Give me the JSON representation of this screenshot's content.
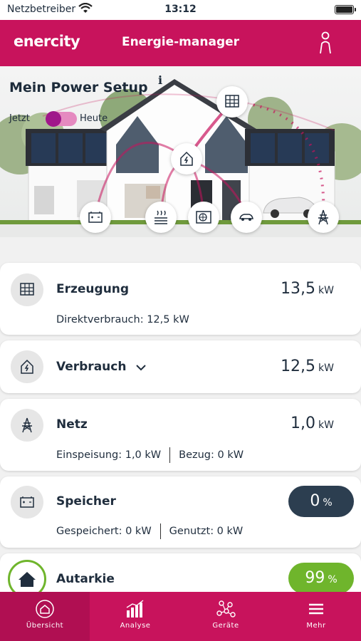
{
  "status_bar": {
    "carrier": "Netzbetreiber",
    "time": "13:12"
  },
  "app_bar": {
    "brand": "enercity",
    "title": "Energie-manager",
    "user_icon": "user-icon"
  },
  "hero": {
    "title": "Mein Power Setup",
    "info_icon": "i",
    "toggle_left": "Jetzt",
    "toggle_right": "Heute",
    "toggle_state": "Jetzt"
  },
  "cards": {
    "erzeugung": {
      "label": "Erzeugung",
      "value": "13,5",
      "unit": "kW",
      "detail": "Direktverbrauch: 12,5 kW",
      "icon": "solar-panel-icon"
    },
    "verbrauch": {
      "label": "Verbrauch",
      "value": "12,5",
      "unit": "kW",
      "icon": "house-bolt-icon"
    },
    "netz": {
      "label": "Netz",
      "value": "1,0",
      "unit": "kW",
      "detail_a": "Einspeisung: 1,0 kW",
      "detail_b": "Bezug: 0 kW",
      "icon": "power-pylon-icon"
    },
    "speicher": {
      "label": "Speicher",
      "value": "0",
      "unit": "%",
      "detail_a": "Gespeichert: 0 kW",
      "detail_b": "Genutzt: 0 kW",
      "icon": "battery-icon",
      "pill_color": "#2c3e50"
    },
    "autarkie": {
      "label": "Autarkie",
      "value": "99",
      "unit": "%",
      "icon": "home-icon",
      "pill_color": "#6fb52c",
      "level_percent": 99
    }
  },
  "tabs": [
    {
      "label": "Übersicht",
      "icon": "overview-icon",
      "active": true
    },
    {
      "label": "Analyse",
      "icon": "bar-chart-icon",
      "active": false
    },
    {
      "label": "Geräte",
      "icon": "devices-icon",
      "active": false
    },
    {
      "label": "Mehr",
      "icon": "menu-icon",
      "active": false
    }
  ]
}
